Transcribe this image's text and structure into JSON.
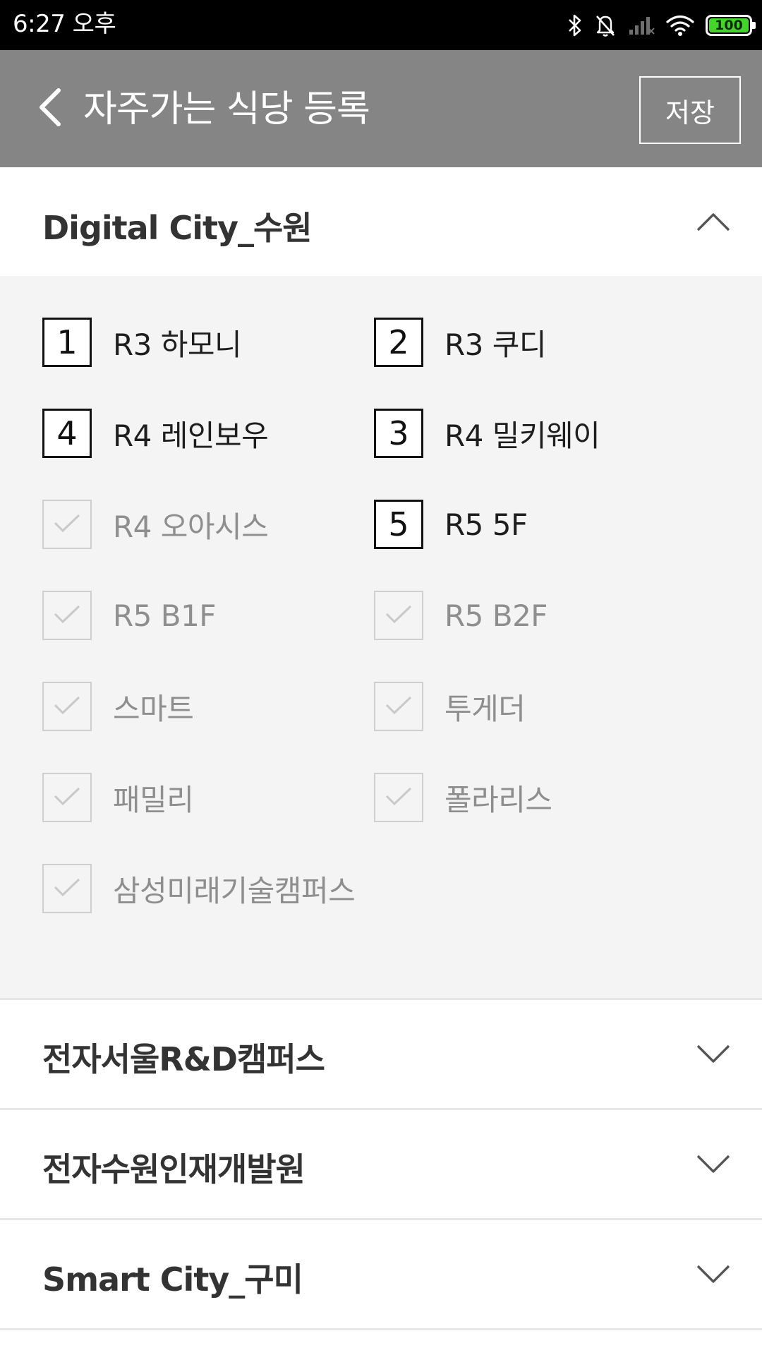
{
  "status_bar": {
    "time": "6:27 오후",
    "battery": "100",
    "icons": [
      "bluetooth-icon",
      "bell-off-icon",
      "signal-icon",
      "wifi-icon",
      "battery-icon"
    ]
  },
  "header": {
    "back_icon": "chevron-left-icon",
    "title": "자주가는 식당 등록",
    "save_label": "저장",
    "background_color": "#858585"
  },
  "sections": [
    {
      "title": "Digital City_수원",
      "expanded": true,
      "restaurants": [
        {
          "label": "R3 하모니",
          "selected": true,
          "order": "1"
        },
        {
          "label": "R3 쿠디",
          "selected": true,
          "order": "2"
        },
        {
          "label": "R4 레인보우",
          "selected": true,
          "order": "4"
        },
        {
          "label": "R4 밀키웨이",
          "selected": true,
          "order": "3"
        },
        {
          "label": "R4 오아시스",
          "selected": false,
          "order": ""
        },
        {
          "label": "R5 5F",
          "selected": true,
          "order": "5"
        },
        {
          "label": "R5 B1F",
          "selected": false,
          "order": ""
        },
        {
          "label": "R5 B2F",
          "selected": false,
          "order": ""
        },
        {
          "label": "스마트",
          "selected": false,
          "order": ""
        },
        {
          "label": "투게더",
          "selected": false,
          "order": ""
        },
        {
          "label": "패밀리",
          "selected": false,
          "order": ""
        },
        {
          "label": "폴라리스",
          "selected": false,
          "order": ""
        },
        {
          "label": "삼성미래기술캠퍼스",
          "selected": false,
          "order": ""
        }
      ]
    },
    {
      "title": "전자서울R&D캠퍼스",
      "expanded": false
    },
    {
      "title": "전자수원인재개발원",
      "expanded": false
    },
    {
      "title": "Smart City_구미",
      "expanded": false
    }
  ],
  "colors": {
    "panel_background": "#f4f4f4",
    "selected_border": "#111111",
    "unselected_border": "#cfcfcf",
    "unselected_text": "#8e8e8e"
  }
}
